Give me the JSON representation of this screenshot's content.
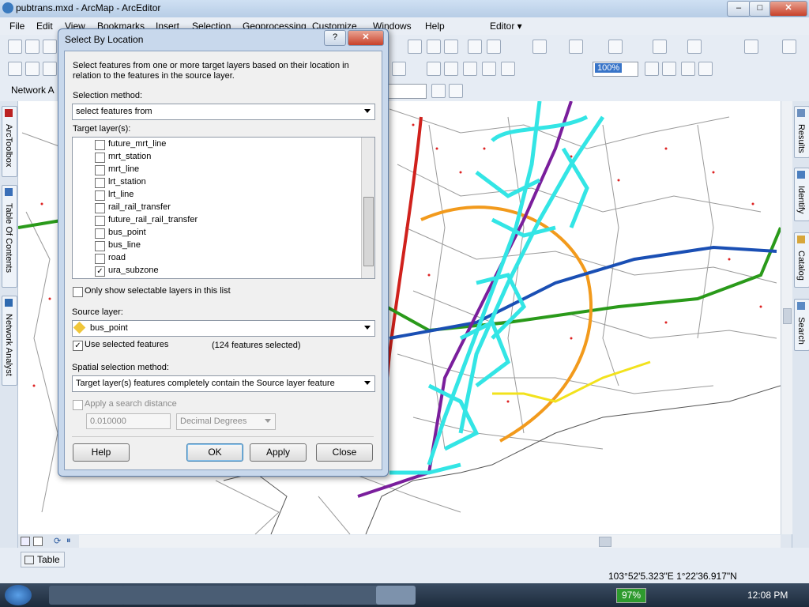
{
  "window": {
    "title": "pubtrans.mxd - ArcMap - ArcEditor"
  },
  "menu": [
    "File",
    "Edit",
    "View",
    "Bookmarks",
    "Insert",
    "Selection",
    "Geoprocessing",
    "Customize",
    "Windows",
    "Help"
  ],
  "toolbar": {
    "network_label": "Network A",
    "zoom_value": "100%",
    "editor_label": "Editor ▾"
  },
  "left_tabs": [
    "ArcToolbox",
    "Table Of Contents",
    "Network Analyst"
  ],
  "right_tabs": [
    "Results",
    "Identify",
    "Catalog",
    "Search"
  ],
  "bottom": {
    "table_tab": "Table",
    "coords": "103°52'5.323\"E  1°22'36.917\"N"
  },
  "taskbar": {
    "battery": "97%",
    "time": "12:08 PM"
  },
  "dialog": {
    "title": "Select By Location",
    "description": "Select features from one or more target layers based on their location in relation to the features in the source layer.",
    "selection_method_label": "Selection method:",
    "selection_method_value": "select features from",
    "target_layers_label": "Target layer(s):",
    "layers": [
      {
        "name": "future_mrt_line",
        "checked": false
      },
      {
        "name": "mrt_station",
        "checked": false
      },
      {
        "name": "mrt_line",
        "checked": false
      },
      {
        "name": "lrt_station",
        "checked": false
      },
      {
        "name": "lrt_line",
        "checked": false
      },
      {
        "name": "rail_rail_transfer",
        "checked": false
      },
      {
        "name": "future_rail_rail_transfer",
        "checked": false
      },
      {
        "name": "bus_point",
        "checked": false
      },
      {
        "name": "bus_line",
        "checked": false
      },
      {
        "name": "road",
        "checked": false
      },
      {
        "name": "ura_subzone",
        "checked": true
      }
    ],
    "only_selectable_label": "Only show selectable layers in this list",
    "source_layer_label": "Source layer:",
    "source_layer_value": "bus_point",
    "use_selected_label": "Use selected features",
    "selected_count": "(124 features selected)",
    "spatial_method_label": "Spatial selection method:",
    "spatial_method_value": "Target layer(s) features completely contain the Source layer feature",
    "search_distance_label": "Apply a search distance",
    "search_distance_value": "0.010000",
    "units_value": "Decimal Degrees",
    "buttons": {
      "help": "Help",
      "ok": "OK",
      "apply": "Apply",
      "close": "Close"
    }
  },
  "colors": {
    "selection": "#33e5e5",
    "mrt_red": "#d0211c",
    "mrt_green": "#2a9a1a",
    "mrt_orange": "#f29a1c",
    "mrt_blue": "#1a4fb4",
    "mrt_purple": "#7a1e9c"
  }
}
